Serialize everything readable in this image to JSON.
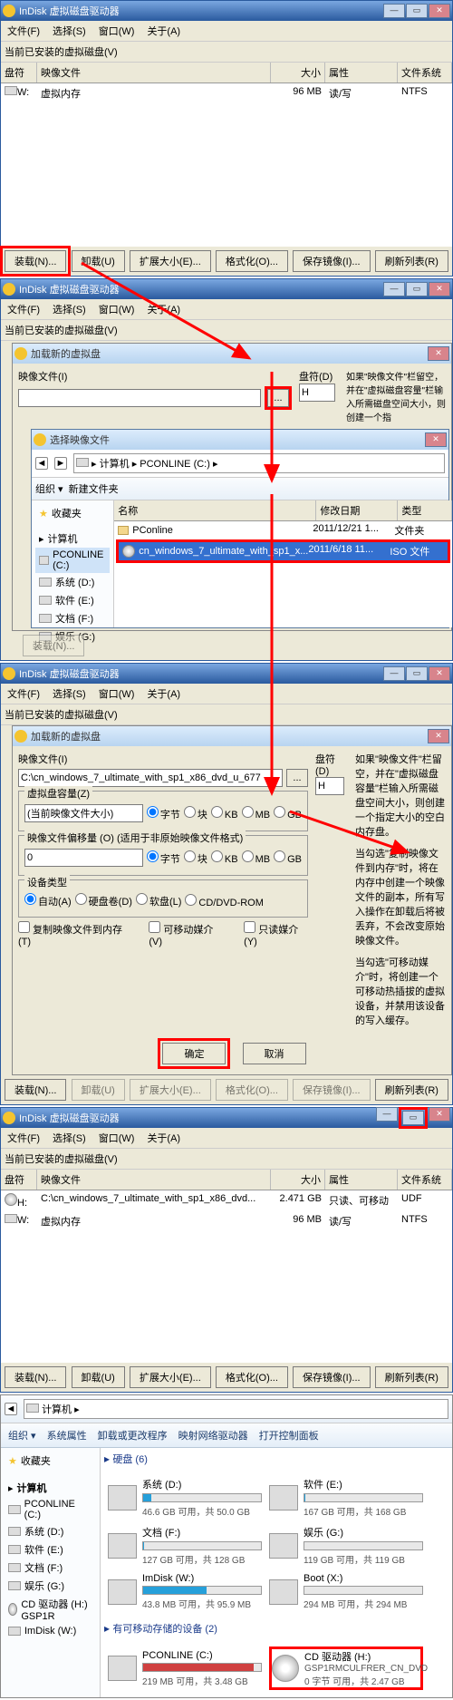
{
  "w1": {
    "title": "InDisk 虚拟磁盘驱动器",
    "menus": [
      "文件(F)",
      "选择(S)",
      "窗口(W)",
      "关于(A)"
    ],
    "sub": "当前已安装的虚拟磁盘(V)",
    "cols": [
      "盘符",
      "映像文件",
      "大小",
      "属性",
      "文件系统"
    ],
    "row1": {
      "drv": "W:",
      "img": "虚拟内存",
      "size": "96 MB",
      "attr": "读/写",
      "fs": "NTFS"
    },
    "btns": {
      "load": "装载(N)...",
      "unload": "卸载(U)",
      "expand": "扩展大小(E)...",
      "format": "格式化(O)...",
      "saveimg": "保存镜像(I)...",
      "refresh": "刷新列表(R)"
    }
  },
  "w2": {
    "dlg_title": "加载新的虚拟盘",
    "img_lbl": "映像文件(I)",
    "drv_lbl": "盘符(D)",
    "drv_val": "H",
    "help1": "如果\"映像文件\"栏留空，并在\"虚拟磁盘容量\"栏输入所需磁盘空间大小，则创建一个指",
    "picker_title": "选择映像文件",
    "path": "计算机 ▸ PCONLINE (C:) ▸",
    "org": "组织 ▾",
    "newf": "新建文件夹",
    "cols": {
      "name": "名称",
      "date": "修改日期",
      "type": "类型"
    },
    "fav": "收藏夹",
    "comp": "计算机",
    "drives": [
      "PCONLINE (C:)",
      "系统 (D:)",
      "软件 (E:)",
      "文档 (F:)",
      "娱乐 (G:)"
    ],
    "files": [
      {
        "n": "PConline",
        "d": "2011/12/21 1...",
        "t": "文件夹"
      },
      {
        "n": "cn_windows_7_ultimate_with_sp1_x...",
        "d": "2011/6/18 11...",
        "t": "ISO 文件"
      }
    ]
  },
  "w3": {
    "title": "InDisk 虚拟磁盘驱动器",
    "dlg": "加载新的虚拟盘",
    "img_lbl": "映像文件(I)",
    "img_val": "C:\\cn_windows_7_ultimate_with_sp1_x86_dvd_u_677",
    "drv_lbl": "盘符(D)",
    "drv_val": "H",
    "help1": "如果\"映像文件\"栏留空，并在\"虚拟磁盘容量\"栏输入所需磁盘空间大小，则创建一个指定大小的空白内存盘。",
    "cap_lbl": "虚拟盘容量(Z)",
    "cap_val": "(当前映像文件大小)",
    "units": {
      "byte": "字节",
      "block": "块",
      "kb": "KB",
      "mb": "MB",
      "gb": "GB"
    },
    "off_lbl": "映像文件偏移量 (O) (适用于非原始映像文件格式)",
    "off_val": "0",
    "help2": "当勾选\"复制映像文件到内存\"时，将在内存中创建一个映像文件的副本，所有写入操作在卸载后将被丢弃，不会改变原始映像文件。",
    "dev_lbl": "设备类型",
    "dev": {
      "auto": "自动(A)",
      "hd": "硬盘卷(D)",
      "fd": "软盘(L)",
      "cd": "CD/DVD-ROM"
    },
    "copy": "复制映像文件到内存 (T)",
    "remov": "可移动媒介 (V)",
    "ro": "只读媒介 (Y)",
    "help3": "当勾选\"可移动媒介\"时，将创建一个可移动热插拔的虚拟设备，并禁用该设备的写入缓存。",
    "ok": "确定",
    "cancel": "取消"
  },
  "w4": {
    "title": "InDisk 虚拟磁盘驱动器",
    "rows": [
      {
        "drv": "H:",
        "img": "C:\\cn_windows_7_ultimate_with_sp1_x86_dvd...",
        "size": "2.471 GB",
        "attr": "只读、可移动",
        "fs": "UDF"
      },
      {
        "drv": "W:",
        "img": "虚拟内存",
        "size": "96 MB",
        "attr": "读/写",
        "fs": "NTFS"
      }
    ]
  },
  "w5": {
    "path": "计算机 ▸",
    "nav": {
      "org": "组织 ▾",
      "prop": "系统属性",
      "uninst": "卸载或更改程序",
      "map": "映射网络驱动器",
      "cp": "打开控制面板"
    },
    "fav": "收藏夹",
    "comp": "计算机",
    "tree": [
      "PCONLINE (C:)",
      "系统 (D:)",
      "软件 (E:)",
      "文档 (F:)",
      "娱乐 (G:)",
      "CD 驱动器 (H:) GSP1R",
      "ImDisk (W:)"
    ],
    "sec1": "硬盘 (6)",
    "sec2": "有可移动存储的设备 (2)",
    "drives": [
      {
        "n": "系统 (D:)",
        "s": "46.6 GB 可用，共 50.0 GB",
        "f": 7
      },
      {
        "n": "软件 (E:)",
        "s": "167 GB 可用，共 168 GB",
        "f": 1
      },
      {
        "n": "文档 (F:)",
        "s": "127 GB 可用，共 128 GB",
        "f": 1
      },
      {
        "n": "娱乐 (G:)",
        "s": "119 GB 可用，共 119 GB",
        "f": 0
      },
      {
        "n": "ImDisk (W:)",
        "s": "43.8 MB 可用，共 95.9 MB",
        "f": 54
      },
      {
        "n": "Boot (X:)",
        "s": "294 MB 可用，共 294 MB",
        "f": 0
      }
    ],
    "rem": [
      {
        "n": "PCONLINE (C:)",
        "s": "219 MB 可用，共 3.48 GB",
        "f": 94,
        "red": true
      },
      {
        "n": "CD 驱动器 (H:)",
        "s2": "GSP1RMCULFRER_CN_DVD",
        "s": "0 字节 可用，共 2.47 GB",
        "cd": true
      }
    ]
  }
}
